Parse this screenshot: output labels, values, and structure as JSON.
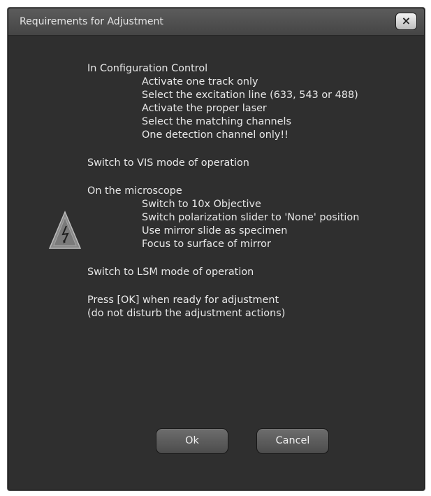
{
  "dialog": {
    "title": "Requirements for Adjustment",
    "close_glyph": "×"
  },
  "instructions": {
    "config_heading": "In Configuration Control",
    "config_items": [
      "Activate one track only",
      "Select the excitation line (633, 543 or 488)",
      "Activate the proper laser",
      "Select the matching channels",
      "One detection channel only!!"
    ],
    "vis_mode": "Switch to VIS mode of operation",
    "microscope_heading": "On the microscope",
    "microscope_items": [
      "Switch to 10x Objective",
      "Switch polarization slider to 'None' position",
      "Use mirror slide as specimen",
      "Focus to surface of mirror"
    ],
    "lsm_mode": "Switch to LSM mode of operation",
    "press_ok_line1": "Press [OK] when ready for adjustment",
    "press_ok_line2": "(do not disturb the adjustment actions)"
  },
  "buttons": {
    "ok_label": "Ok",
    "cancel_label": "Cancel"
  },
  "icons": {
    "warning": "high-voltage-warning-triangle",
    "close": "close-x"
  },
  "colors": {
    "dialog_bg": "#2f2f2f",
    "title_bar": "#4f4f4f",
    "text": "#e8e8e8"
  }
}
